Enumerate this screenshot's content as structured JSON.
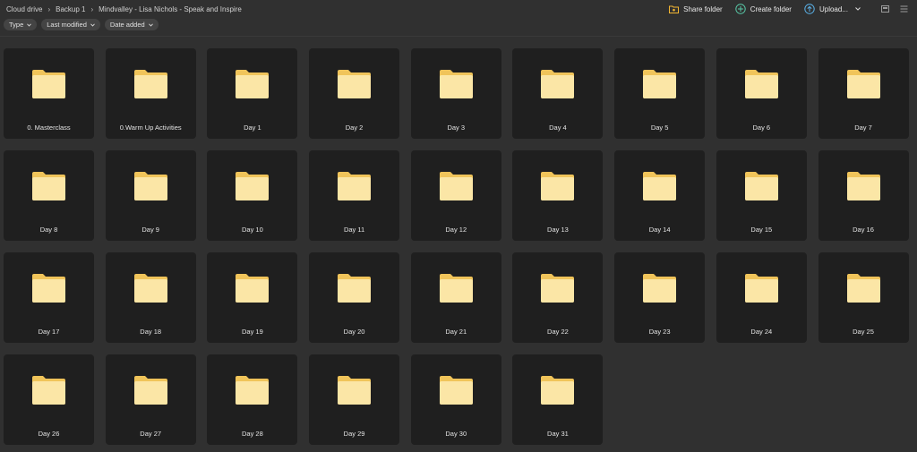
{
  "breadcrumb": [
    "Cloud drive",
    "Backup 1",
    "Mindvalley - Lisa Nichols - Speak and Inspire"
  ],
  "actions": {
    "share_label": "Share folder",
    "create_label": "Create folder",
    "upload_label": "Upload..."
  },
  "filters": [
    "Type",
    "Last modified",
    "Date added"
  ],
  "folders": [
    "0. Masterclass",
    "0.Warm Up Activities",
    "Day 1",
    "Day 2",
    "Day 3",
    "Day 4",
    "Day 5",
    "Day 6",
    "Day 7",
    "Day 8",
    "Day 9",
    "Day 10",
    "Day 11",
    "Day 12",
    "Day 13",
    "Day 14",
    "Day 15",
    "Day 16",
    "Day 17",
    "Day 18",
    "Day 19",
    "Day 20",
    "Day 21",
    "Day 22",
    "Day 23",
    "Day 24",
    "Day 25",
    "Day 26",
    "Day 27",
    "Day 28",
    "Day 29",
    "Day 30",
    "Day 31"
  ],
  "colors": {
    "background": "#303030",
    "tile": "#1f1f1f",
    "folder_back": "#f0c45a",
    "folder_front": "#fbe6a6",
    "share_icon": "#f2b632",
    "create_icon": "#58c7a6",
    "upload_icon": "#5ab0e6"
  },
  "icons": {
    "share": "share-folder-icon",
    "create": "create-folder-icon",
    "upload": "upload-icon",
    "view": "grid-view-icon",
    "list": "list-view-icon",
    "folder": "folder-icon"
  }
}
